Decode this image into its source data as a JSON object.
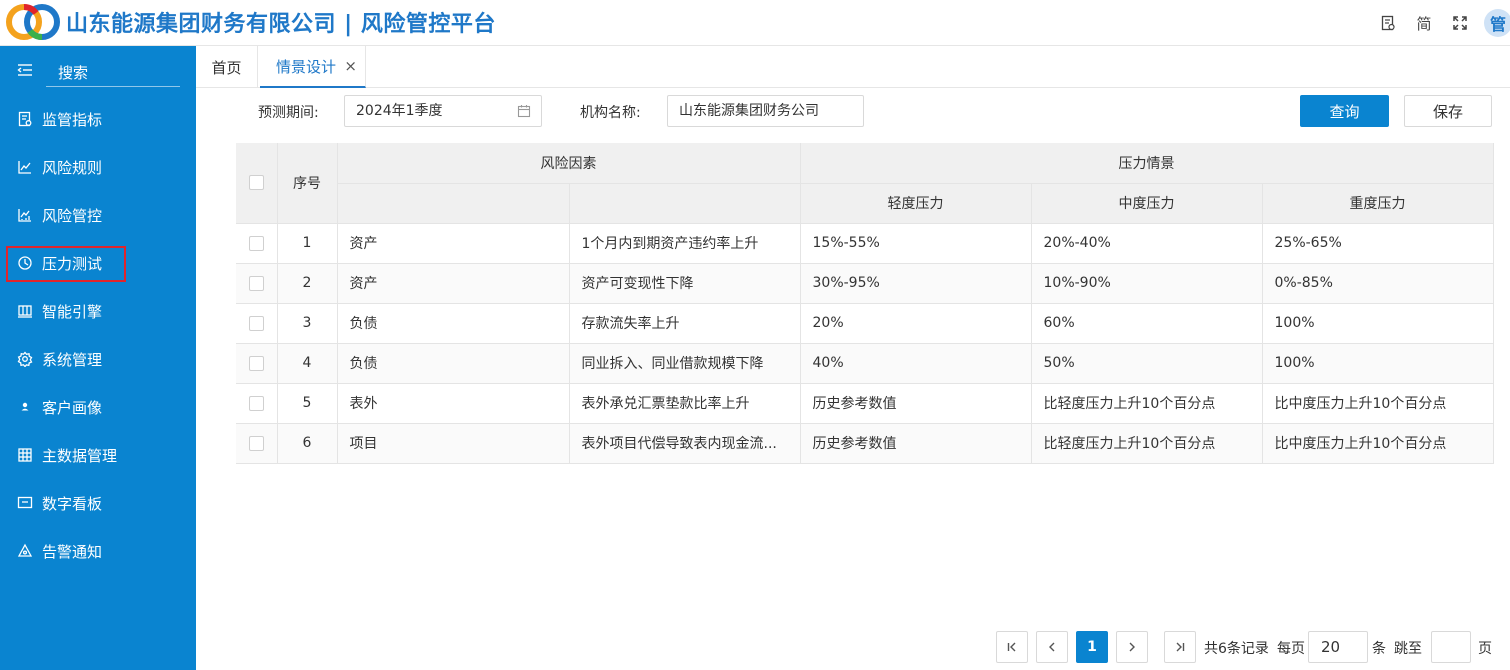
{
  "header": {
    "title": "山东能源集团财务有限公司 | 风险管控平台",
    "tools": [
      "document-icon",
      "简",
      "fullscreen-icon"
    ],
    "avatar_text": "管"
  },
  "sidebar": {
    "search_label": "搜索",
    "items": [
      {
        "label": "监管指标",
        "icon": "document-check-icon"
      },
      {
        "label": "风险规则",
        "icon": "line-chart-icon"
      },
      {
        "label": "风险管控",
        "icon": "bar-chart-icon"
      },
      {
        "label": "压力测试",
        "icon": "gauge-icon"
      },
      {
        "label": "智能引擎",
        "icon": "grid-icon"
      },
      {
        "label": "系统管理",
        "icon": "gear-icon"
      },
      {
        "label": "客户画像",
        "icon": "user-icon"
      },
      {
        "label": "主数据管理",
        "icon": "table-icon"
      },
      {
        "label": "数字看板",
        "icon": "monitor-icon"
      },
      {
        "label": "告警通知",
        "icon": "alert-icon"
      }
    ]
  },
  "tabs": {
    "home": "首页",
    "active": "情景设计",
    "close": "×"
  },
  "filters": {
    "period_label": "预测期间:",
    "period_value": "2024年1季度",
    "org_label": "机构名称:",
    "org_value": "山东能源集团财务公司"
  },
  "buttons": {
    "query": "查询",
    "save": "保存"
  },
  "table": {
    "h_index": "序号",
    "h_factor": "风险因素",
    "h_scenario": "压力情景",
    "h_light": "轻度压力",
    "h_medium": "中度压力",
    "h_heavy": "重度压力",
    "rows": [
      {
        "idx": "1",
        "cat": "资产",
        "factor": "1个月内到期资产违约率上升",
        "light": "15%-55%",
        "medium": "20%-40%",
        "heavy": "25%-65%"
      },
      {
        "idx": "2",
        "cat": "资产",
        "factor": "资产可变现性下降",
        "light": "30%-95%",
        "medium": "10%-90%",
        "heavy": "0%-85%"
      },
      {
        "idx": "3",
        "cat": "负债",
        "factor": "存款流失率上升",
        "light": "20%",
        "medium": "60%",
        "heavy": "100%"
      },
      {
        "idx": "4",
        "cat": "负债",
        "factor": "同业拆入、同业借款规模下降",
        "light": "40%",
        "medium": "50%",
        "heavy": "100%"
      },
      {
        "idx": "5",
        "cat": "表外",
        "factor": "表外承兑汇票垫款比率上升",
        "light": "历史参考数值",
        "medium": "比轻度压力上升10个百分点",
        "heavy": "比中度压力上升10个百分点"
      },
      {
        "idx": "6",
        "cat": "项目",
        "factor": "表外项目代偿导致表内现金流...",
        "light": "历史参考数值",
        "medium": "比轻度压力上升10个百分点",
        "heavy": "比中度压力上升10个百分点"
      }
    ]
  },
  "pagination": {
    "current_page": "1",
    "total_text": "共6条记录",
    "per_page_label": "每页",
    "per_page_value": "20",
    "unit": "条",
    "jump_label": "跳至",
    "jump_value": "",
    "page_unit": "页"
  },
  "colors": {
    "brand": "#1f78c8",
    "sidebar": "#0a84d0",
    "highlight": "#e0242b"
  }
}
